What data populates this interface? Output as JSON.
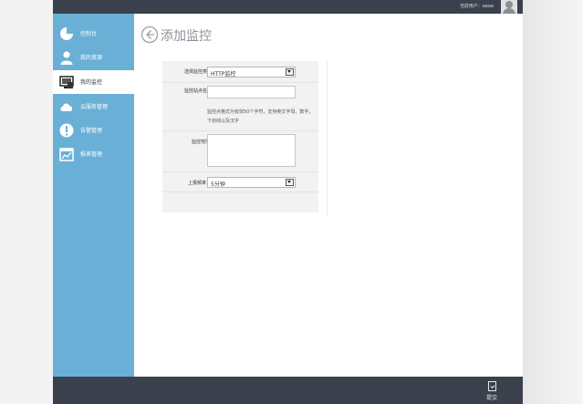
{
  "header": {
    "current_user_label": "当前用户：aaaa"
  },
  "sidebar": {
    "items": [
      {
        "label": "控制台",
        "icon": "pie-chart-icon",
        "active": false
      },
      {
        "label": "我的资源",
        "icon": "user-icon",
        "active": false
      },
      {
        "label": "我的监控",
        "icon": "monitor-icon",
        "active": true
      },
      {
        "label": "云服务管理",
        "icon": "cloud-icon",
        "active": false
      },
      {
        "label": "告警管理",
        "icon": "alert-icon",
        "active": false
      },
      {
        "label": "报表管理",
        "icon": "report-chart-icon",
        "active": false
      }
    ]
  },
  "main": {
    "title": "添加监控",
    "form": {
      "type_label": "选择监控类型",
      "type_value": "HTTP监控",
      "name_label": "监控站点名称",
      "name_value": "",
      "hint": "监控点格式为有效50个字符，支持英文字母，数字，下划线以及汉字",
      "address_label": "监控地址",
      "address_value": "",
      "frequency_label": "上报频率",
      "frequency_value": "5分钟"
    }
  },
  "footer": {
    "submit_label": "提交"
  },
  "colors": {
    "sidebar_bg": "#6ab0d6",
    "topbar_bg": "#3b414c",
    "panel_bg": "#f2f2f2"
  }
}
